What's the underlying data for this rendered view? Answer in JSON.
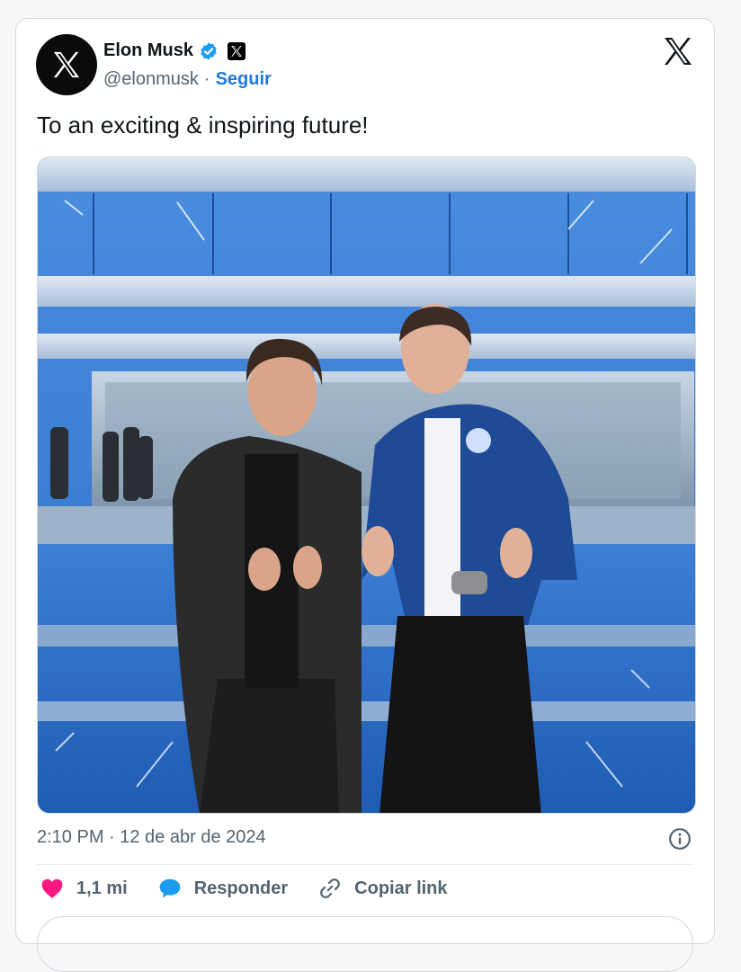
{
  "author": {
    "name": "Elon Musk",
    "handle": "@elonmusk",
    "separator": "·",
    "follow_label": "Seguir"
  },
  "tweet": {
    "text": "To an exciting & inspiring future!",
    "timestamp": "2:10 PM · 12 de abr de 2024"
  },
  "actions": {
    "likes_count": "1,1 mi",
    "reply_label": "Responder",
    "copy_link_label": "Copiar link"
  },
  "icons": {
    "avatar": "x-logo-icon",
    "verified": "verified-badge-icon",
    "affiliate": "x-badge-icon",
    "corner": "x-logo-icon",
    "info": "info-icon",
    "like": "heart-icon",
    "reply": "speech-bubble-icon",
    "copy_link": "link-icon"
  },
  "colors": {
    "accent": "#1d9bf0",
    "like": "#f91880",
    "follow": "#1d7bd9",
    "muted_text": "#536471"
  }
}
